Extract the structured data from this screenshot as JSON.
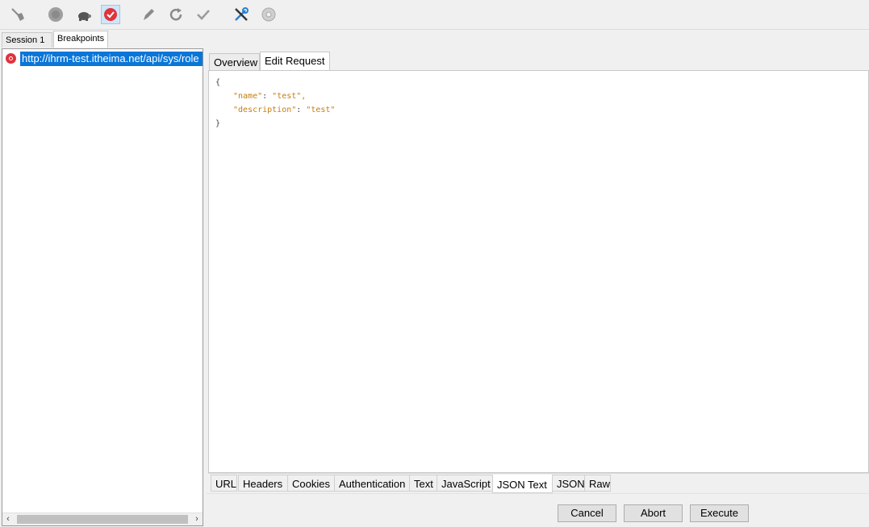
{
  "toolbar": {
    "icons": [
      "broom-icon",
      "record-circle-icon",
      "turtle-icon",
      "breakpoint-icon",
      "pen-icon",
      "refresh-icon",
      "check-icon",
      "tools-icon",
      "settings-gear-icon"
    ]
  },
  "session_tabs": [
    {
      "label": "Session 1 *"
    },
    {
      "label": "Breakpoints"
    }
  ],
  "breakpoint": {
    "url": "http://ihrm-test.itheima.net/api/sys/role"
  },
  "request_tabs": [
    {
      "label": "Overview"
    },
    {
      "label": "Edit Request"
    }
  ],
  "editor": {
    "open_brace": "{",
    "line1_key": "\"name\"",
    "line1_colon": ": ",
    "line1_value": "\"test\",",
    "line2_key": "\"description\"",
    "line2_colon": ": ",
    "line2_value": "\"test\"",
    "close_brace": "}"
  },
  "body_tabs": [
    {
      "label": "URL"
    },
    {
      "label": "Headers"
    },
    {
      "label": "Cookies"
    },
    {
      "label": "Authentication"
    },
    {
      "label": "Text"
    },
    {
      "label": "JavaScript"
    },
    {
      "label": "JSON Text"
    },
    {
      "label": "JSON"
    },
    {
      "label": "Raw"
    }
  ],
  "actions": {
    "cancel": "Cancel",
    "abort": "Abort",
    "execute": "Execute"
  },
  "colors": {
    "selection": "#0a76d8",
    "json_key": "#c77d10",
    "breakpoint_red": "#e0333c"
  }
}
